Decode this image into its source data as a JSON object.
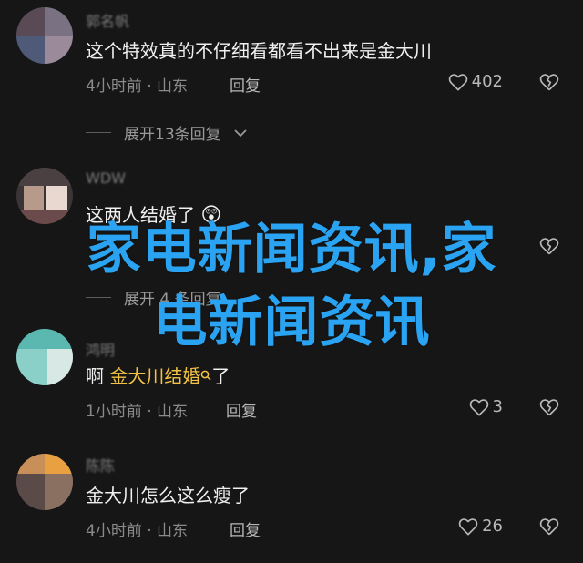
{
  "comments": [
    {
      "username": "郭名帆",
      "text": "这个特效真的不仔细看都看不出来是金大川",
      "time": "4小时前",
      "location": "山东",
      "reply_label": "回复",
      "likes": "402"
    },
    {
      "username": "WDW",
      "text": "这两人结婚了",
      "emoji": "😲"
    },
    {
      "username": "鸿明",
      "text_prefix": "啊 ",
      "text_link": "金大川结婚",
      "text_suffix": "了",
      "time": "1小时前",
      "location": "山东",
      "reply_label": "回复",
      "likes": "3"
    },
    {
      "username": "陈陈",
      "text": "金大川怎么这么瘦了",
      "time": "4小时前",
      "location": "山东",
      "reply_label": "回复",
      "likes": "26"
    }
  ],
  "expand_replies": {
    "label": "展开13条回复"
  },
  "partial_expand": {
    "label": "展开 4 条回复"
  },
  "watermark": {
    "line1": "家电新闻资讯,家",
    "line2": "电新闻资讯"
  },
  "colors": {
    "background": "#161616",
    "link": "#f3c343",
    "watermark": "#2aa4f2"
  }
}
